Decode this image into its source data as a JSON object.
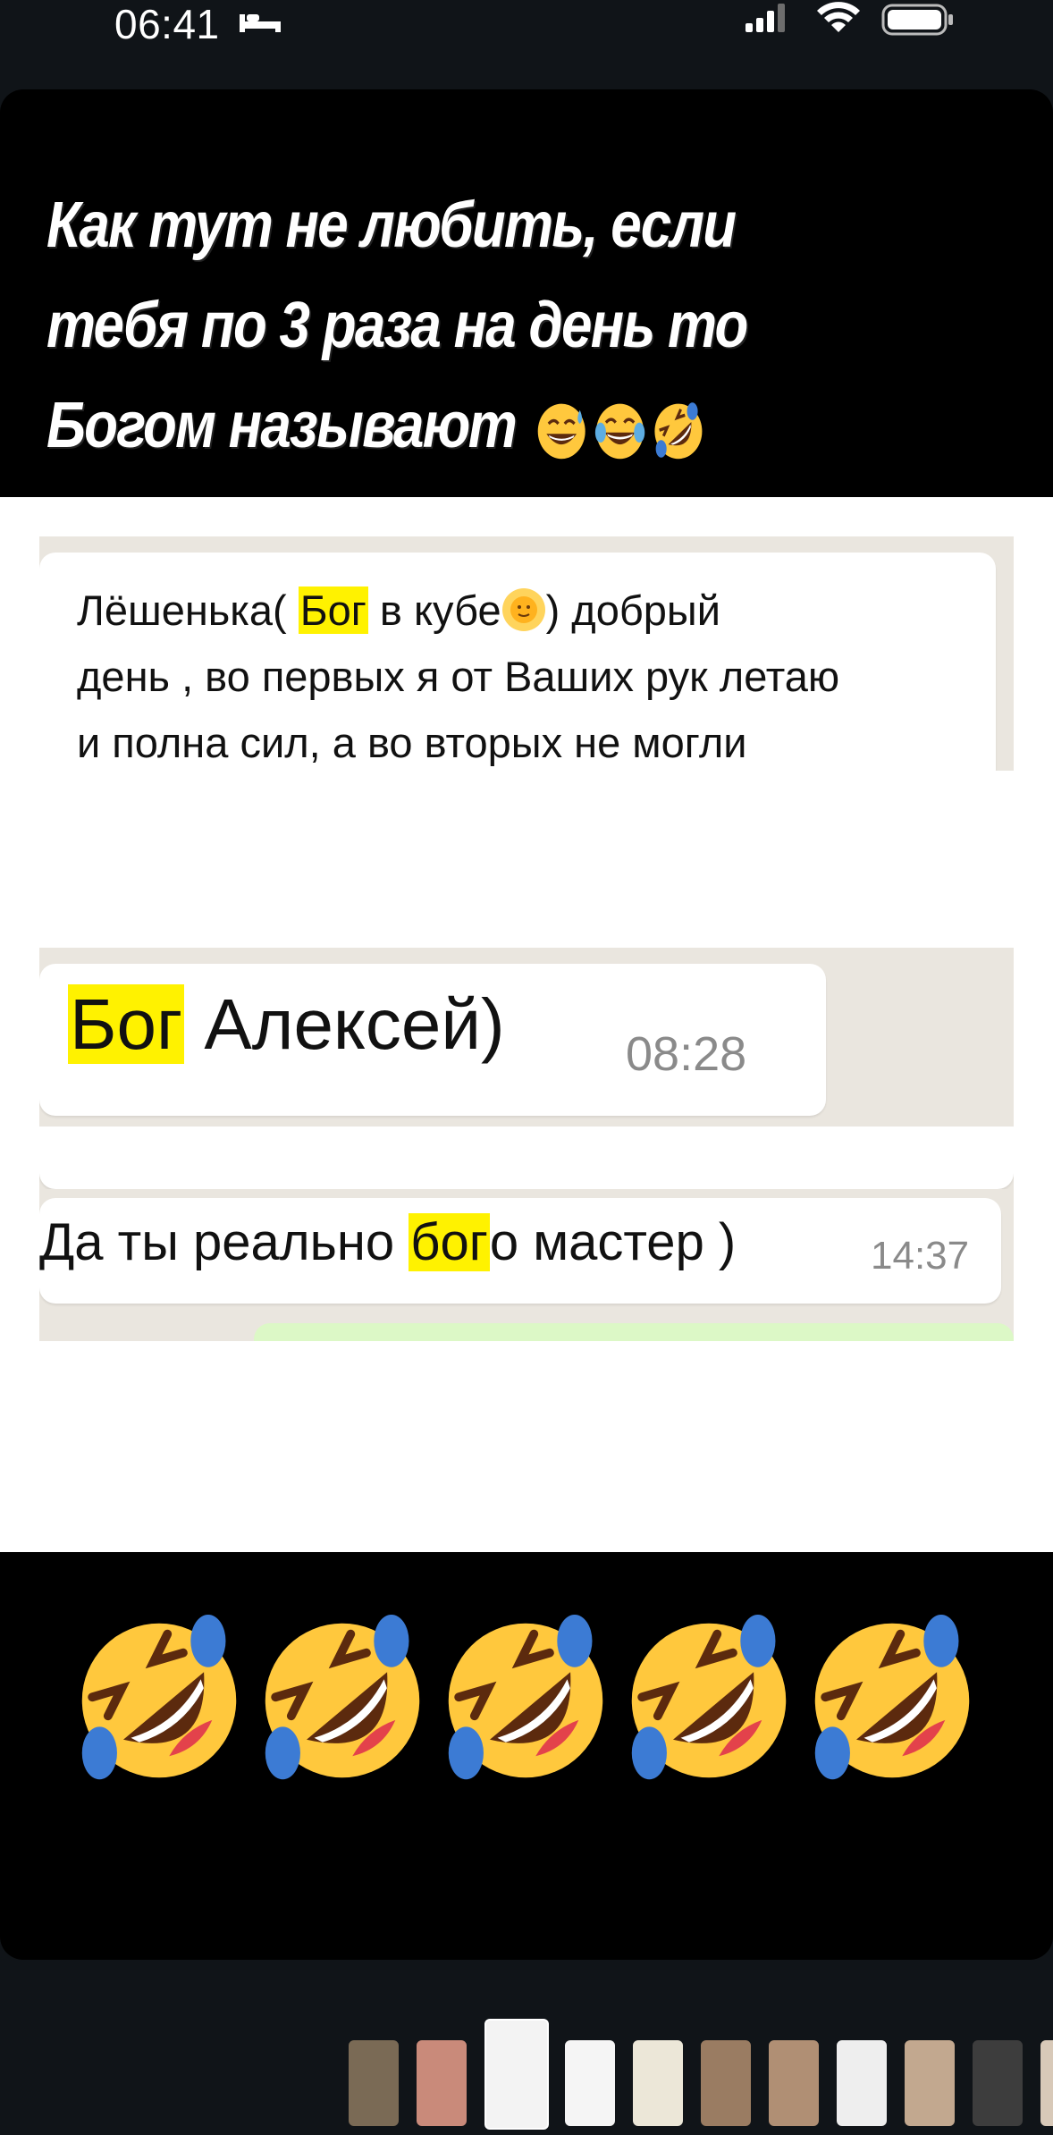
{
  "status_bar": {
    "time": "06:41",
    "icons": [
      "bed-icon",
      "signal-icon",
      "wifi-icon",
      "battery-icon"
    ]
  },
  "story": {
    "caption_lines": [
      "Как тут не любить, если",
      "тебя по 3 раза на день то",
      "Богом называют"
    ],
    "caption_emojis": [
      "sweat-smile-emoji",
      "joy-emoji",
      "rofl-emoji"
    ],
    "chat1": {
      "pre": "Лёшенька( ",
      "highlight": "Бог",
      "post": " в кубе",
      "post2": ") добрый",
      "line2": "день , во первых я от Ваших рук летаю",
      "line3": "и полна сил, а во вторых не могли"
    },
    "chat2": {
      "highlight": "Бог",
      "text": " Алексей)",
      "time": "08:28"
    },
    "chat3": {
      "text_pre": "Да ты реально ",
      "highlight": "бог",
      "text_post": "о мастер )",
      "time": "14:37"
    },
    "big_emojis": [
      "rofl-emoji",
      "rofl-emoji",
      "rofl-emoji",
      "rofl-emoji",
      "rofl-emoji"
    ]
  },
  "colors": {
    "background": "#101418",
    "story_bg": "#000000",
    "highlight": "#fff200",
    "chat_bg": "#eae6df",
    "emoji_yellow": "#ffc83d"
  }
}
